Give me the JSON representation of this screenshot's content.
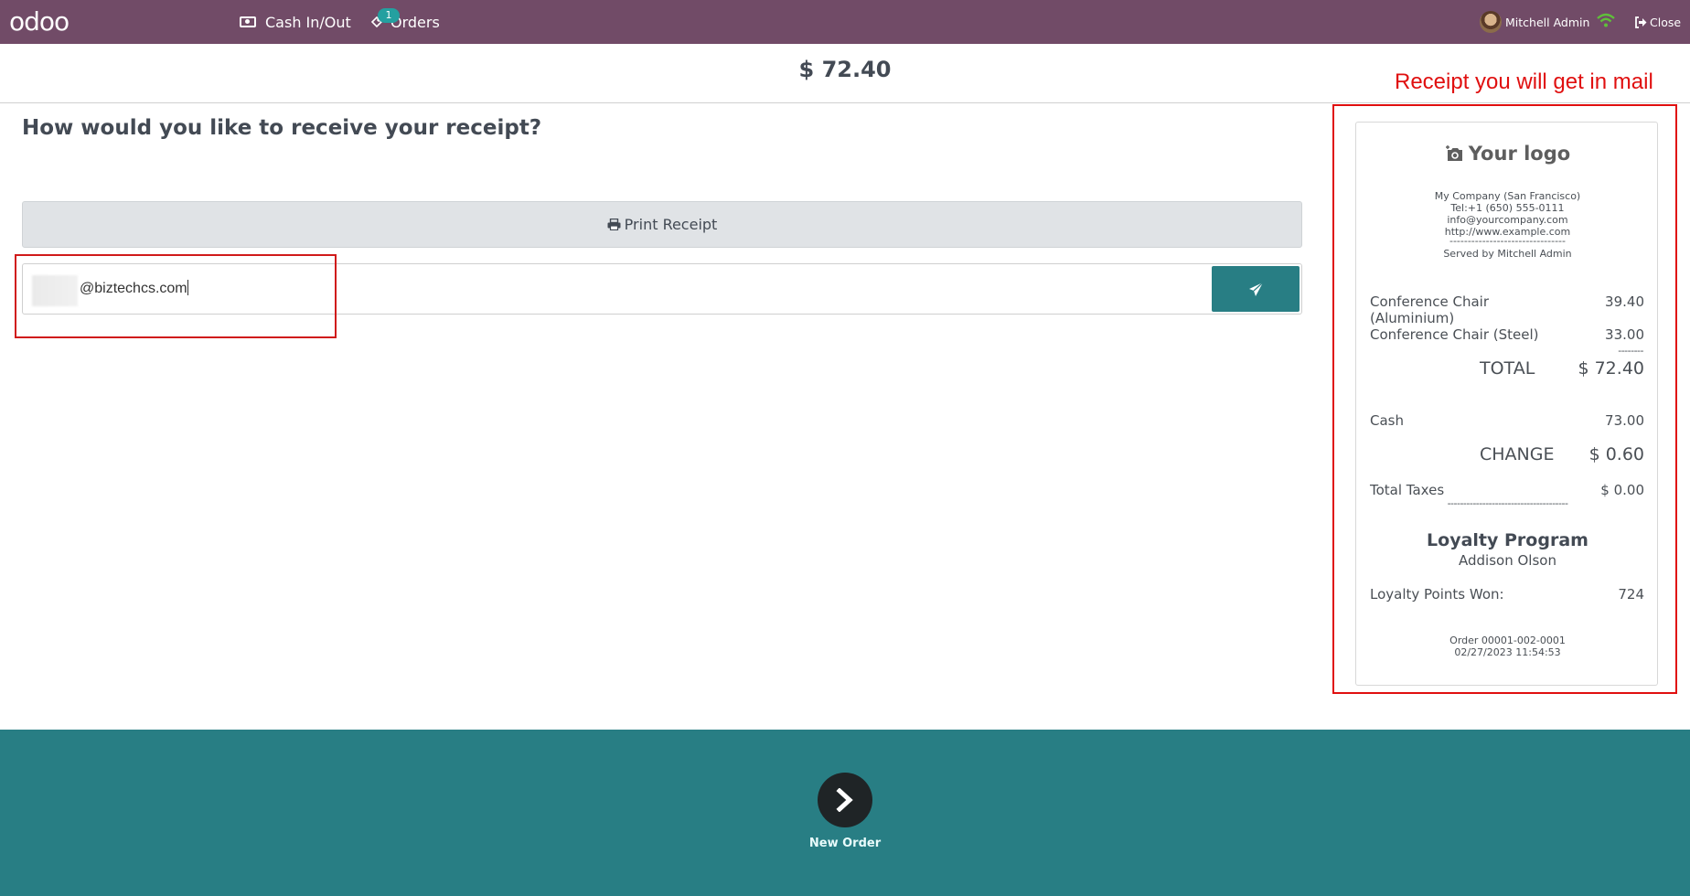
{
  "navbar": {
    "logo": "odoo",
    "cash_in_out": "Cash In/Out",
    "orders": "Orders",
    "orders_badge": "1",
    "user_name": "Mitchell Admin",
    "close": "Close",
    "background_color": "#714b67"
  },
  "header": {
    "amount": "$ 72.40"
  },
  "main": {
    "heading": "How would you like to receive your receipt?",
    "print_button": "Print Receipt",
    "email_value": "s@biztechcs.com",
    "email_visible_text": "@biztechcs.com",
    "send_button_icon": "paper-plane-icon",
    "accent_color": "#287e84"
  },
  "annotation": {
    "receipt_caption": "Receipt you will get in mail",
    "color": "#e00f0f"
  },
  "receipt": {
    "logo_text": "Your logo",
    "company": {
      "name": "My Company (San Francisco)",
      "tel": "Tel:+1 (650) 555-0111",
      "email": "info@yourcompany.com",
      "website": "http://www.example.com",
      "separator": "--------------------------------",
      "served_by": "Served by Mitchell Admin"
    },
    "lines": [
      {
        "product": "Conference Chair",
        "product_cont": "(Aluminium)",
        "price": "39.40"
      },
      {
        "product": "Conference Chair (Steel)",
        "price": "33.00"
      }
    ],
    "subtotal_separator": "--------",
    "total_label": "TOTAL",
    "total_value": "$ 72.40",
    "payment_label": "Cash",
    "payment_value": "73.00",
    "change_label": "CHANGE",
    "change_value": "$ 0.60",
    "taxes_label": "Total Taxes",
    "taxes_value": "$ 0.00",
    "taxes_separator": "--------------------------------------",
    "loyalty_title": "Loyalty Program",
    "loyalty_customer": "Addison Olson",
    "loyalty_points_label": "Loyalty Points Won:",
    "loyalty_points_value": "724",
    "order_ref": "Order 00001-002-0001",
    "order_datetime": "02/27/2023 11:54:53"
  },
  "footer": {
    "new_order": "New Order"
  }
}
